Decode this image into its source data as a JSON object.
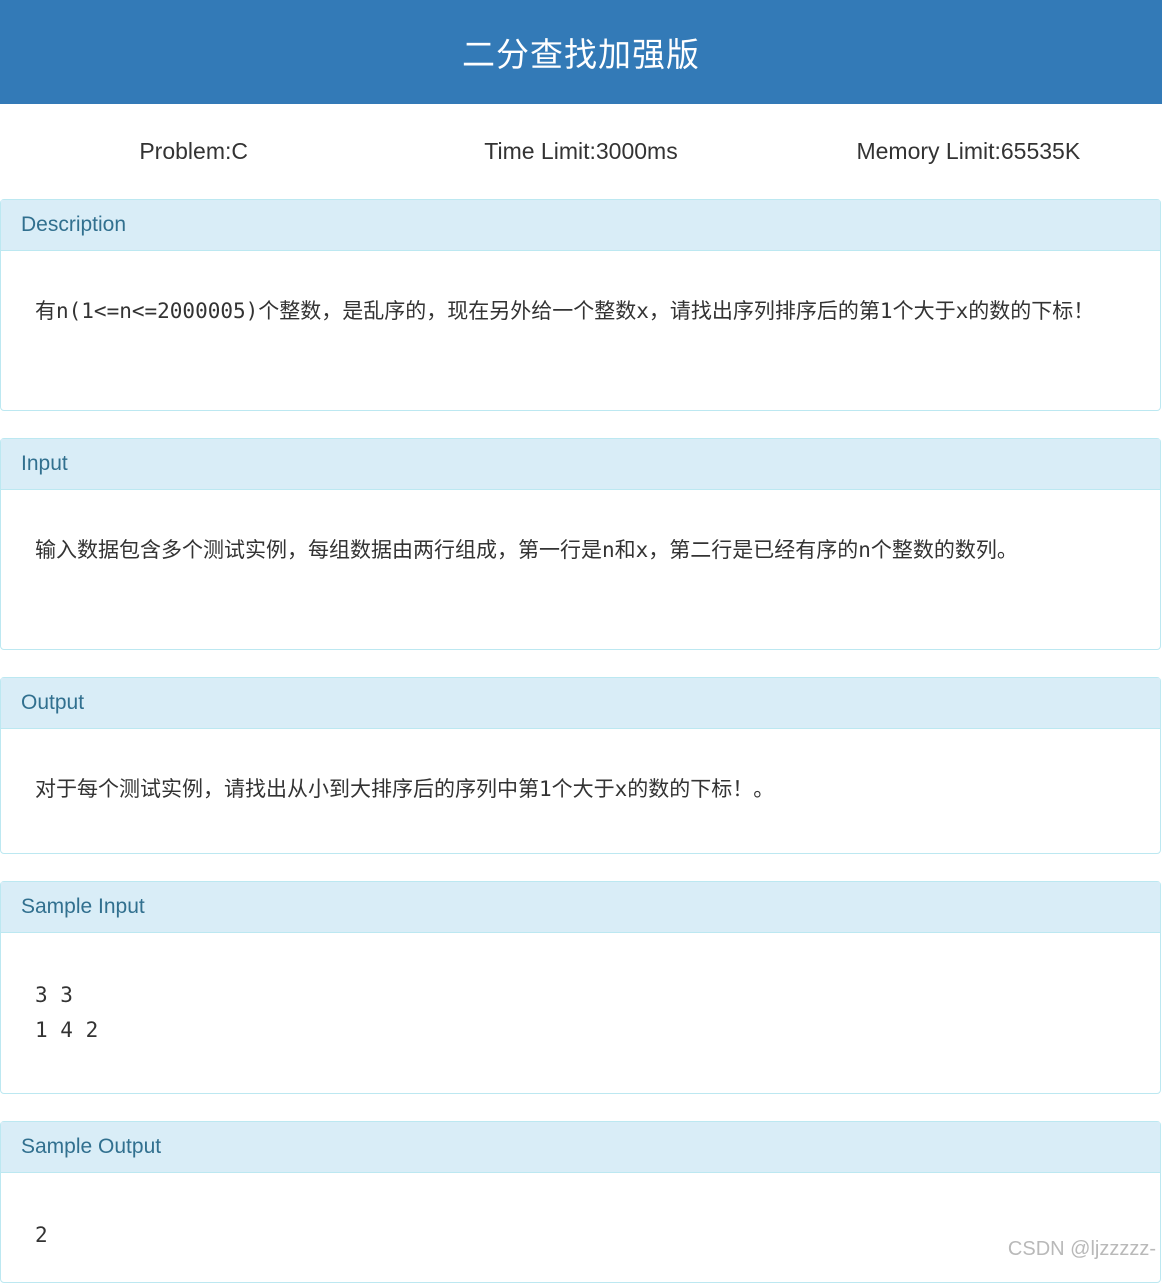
{
  "page": {
    "title": "二分查找加强版"
  },
  "limits": {
    "problem": "Problem:C",
    "time": "Time Limit:3000ms",
    "memory": "Memory Limit:65535K"
  },
  "sections": {
    "description": {
      "heading": "Description",
      "body": "有n(1<=n<=2000005)个整数，是乱序的，现在另外给一个整数x，请找出序列排序后的第1个大于x的数的下标！"
    },
    "input": {
      "heading": "Input",
      "body": "输入数据包含多个测试实例，每组数据由两行组成，第一行是n和x，第二行是已经有序的n个整数的数列。"
    },
    "output": {
      "heading": "Output",
      "body": "对于每个测试实例，请找出从小到大排序后的序列中第1个大于x的数的下标！。"
    },
    "sample_input": {
      "heading": "Sample Input",
      "body": "3 3\n1 4 2"
    },
    "sample_output": {
      "heading": "Sample Output",
      "body": "2"
    }
  },
  "watermark": "CSDN @ljzzzzz-",
  "colors": {
    "title_bar": "#337ab7",
    "panel_heading_bg": "#d9edf7",
    "panel_heading_text": "#31708f",
    "panel_border": "#bce8f1"
  }
}
